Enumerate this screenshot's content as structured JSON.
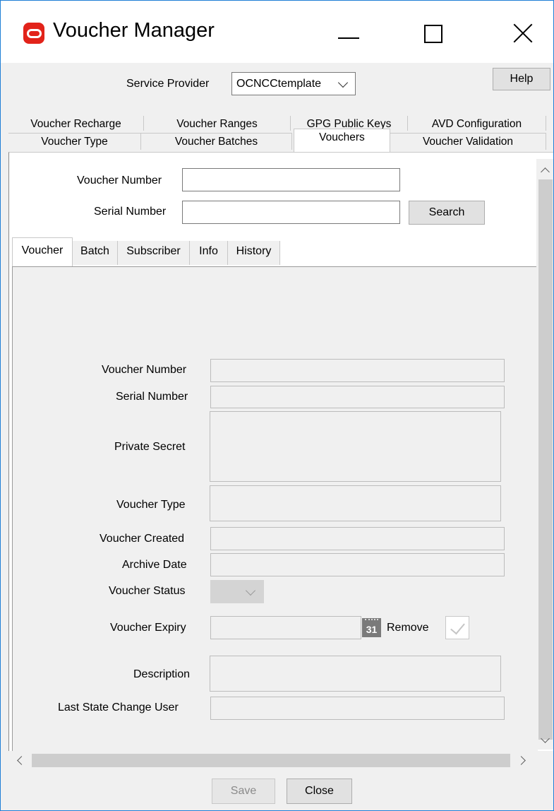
{
  "window": {
    "title": "Voucher Manager"
  },
  "header": {
    "service_provider_label": "Service Provider",
    "service_provider_value": "OCNCCtemplate",
    "help_label": "Help"
  },
  "tabs": {
    "top_row": [
      "Voucher Recharge",
      "Voucher Ranges",
      "GPG Public Keys",
      "AVD Configuration"
    ],
    "bottom_row": [
      "Voucher Type",
      "Voucher Batches",
      "Vouchers",
      "Voucher Validation"
    ],
    "active": "Vouchers"
  },
  "search": {
    "voucher_number_label": "Voucher Number",
    "voucher_number_value": "",
    "serial_number_label": "Serial Number",
    "serial_number_value": "",
    "search_button": "Search"
  },
  "inner_tabs": {
    "items": [
      "Voucher",
      "Batch",
      "Subscriber",
      "Info",
      "History"
    ],
    "active": "Voucher"
  },
  "details": {
    "voucher_number_label": "Voucher Number",
    "serial_number_label": "Serial Number",
    "private_secret_label": "Private Secret",
    "voucher_type_label": "Voucher Type",
    "voucher_created_label": "Voucher Created",
    "archive_date_label": "Archive Date",
    "voucher_status_label": "Voucher Status",
    "voucher_expiry_label": "Voucher Expiry",
    "calendar_day": "31",
    "remove_label": "Remove",
    "description_label": "Description",
    "last_state_change_user_label": "Last State Change User"
  },
  "footer": {
    "save_label": "Save",
    "close_label": "Close"
  },
  "colors": {
    "accent_border": "#1f7fd6",
    "oracle_red": "#e2231a"
  }
}
